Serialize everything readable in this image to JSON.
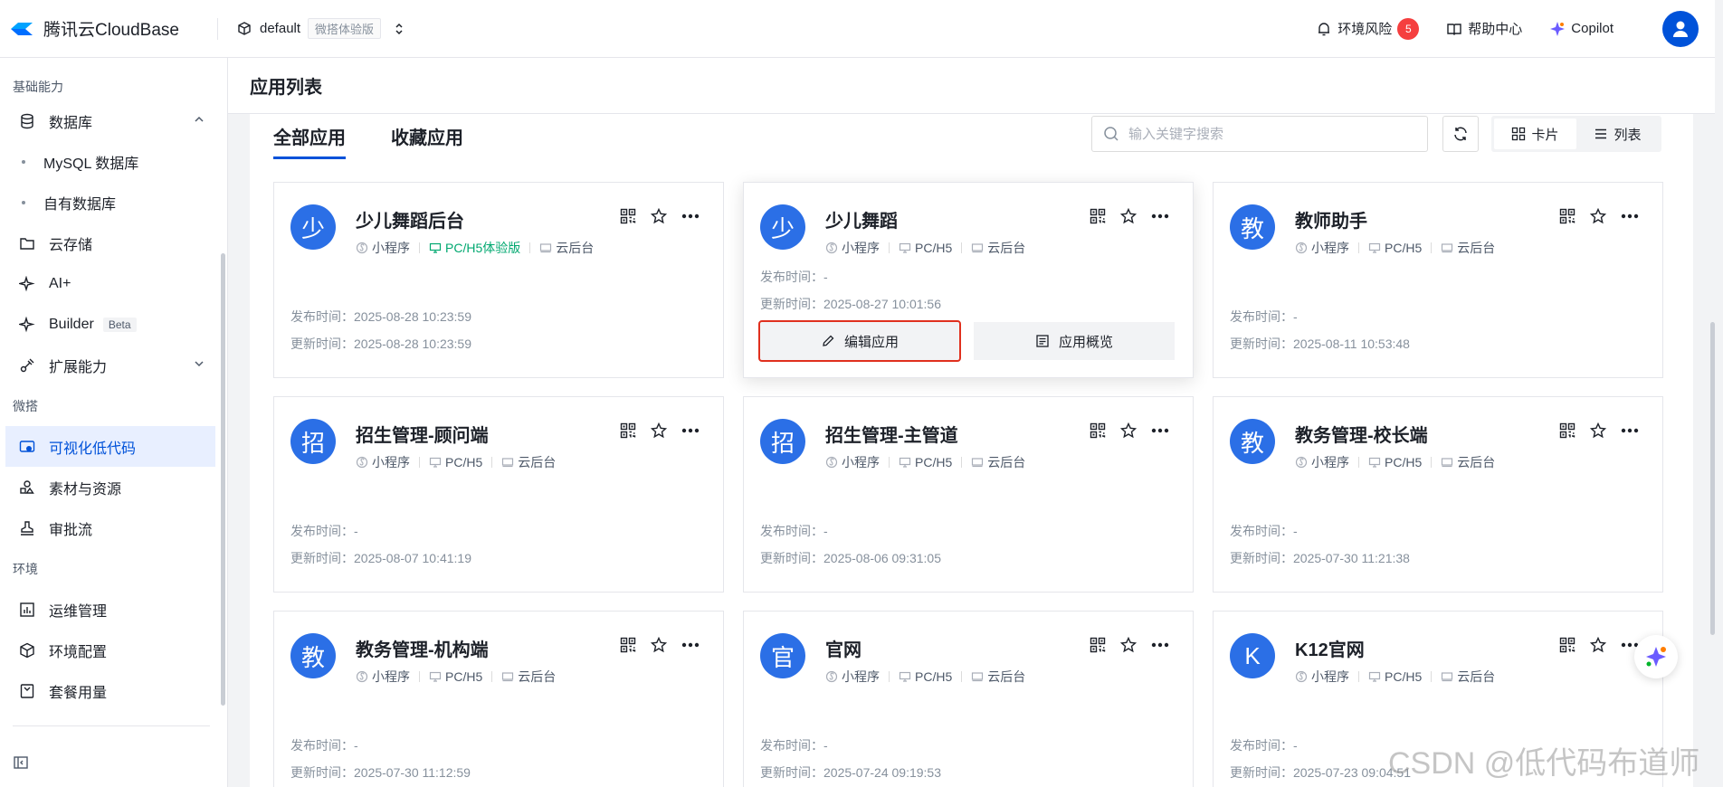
{
  "brand": {
    "name": "腾讯云CloudBase"
  },
  "env": {
    "name": "default",
    "tag": "微搭体验版"
  },
  "top_right": {
    "risk_label": "环境风险",
    "risk_count": "5",
    "help_label": "帮助中心",
    "copilot_label": "Copilot"
  },
  "sidebar": {
    "section_basic": "基础能力",
    "database": "数据库",
    "mysql": "MySQL 数据库",
    "own_db": "自有数据库",
    "storage": "云存储",
    "ai": "AI+",
    "builder": "Builder",
    "builder_badge": "Beta",
    "extension": "扩展能力",
    "section_weda": "微搭",
    "visual_lowcode": "可视化低代码",
    "assets": "素材与资源",
    "approval": "审批流",
    "section_env": "环境",
    "ops": "运维管理",
    "env_config": "环境配置",
    "plan_usage": "套餐用量"
  },
  "page": {
    "title": "应用列表"
  },
  "tabs": {
    "all": "全部应用",
    "favorites": "收藏应用"
  },
  "search": {
    "placeholder": "输入关键字搜索"
  },
  "view": {
    "card": "卡片",
    "list": "列表"
  },
  "labels": {
    "publish_time": "发布时间：",
    "update_time": "更新时间：",
    "edit_app": "编辑应用",
    "app_overview": "应用概览"
  },
  "apps": [
    {
      "avatar": "少",
      "name": "少儿舞蹈后台",
      "tags": [
        "小程序",
        "PC/H5体验版",
        "云后台"
      ],
      "publish": "2025-08-28 10:23:59",
      "update": "2025-08-28 10:23:59"
    },
    {
      "avatar": "少",
      "name": "少儿舞蹈",
      "tags": [
        "小程序",
        "PC/H5",
        "云后台"
      ],
      "publish": "-",
      "update": "2025-08-27 10:01:56"
    },
    {
      "avatar": "教",
      "name": "教师助手",
      "tags": [
        "小程序",
        "PC/H5",
        "云后台"
      ],
      "publish": "-",
      "update": "2025-08-11 10:53:48"
    },
    {
      "avatar": "招",
      "name": "招生管理-顾问端",
      "tags": [
        "小程序",
        "PC/H5",
        "云后台"
      ],
      "publish": "-",
      "update": "2025-08-07 10:41:19"
    },
    {
      "avatar": "招",
      "name": "招生管理-主管道",
      "tags": [
        "小程序",
        "PC/H5",
        "云后台"
      ],
      "publish": "-",
      "update": "2025-08-06 09:31:05"
    },
    {
      "avatar": "教",
      "name": "教务管理-校长端",
      "tags": [
        "小程序",
        "PC/H5",
        "云后台"
      ],
      "publish": "-",
      "update": "2025-07-30 11:21:38"
    },
    {
      "avatar": "教",
      "name": "教务管理-机构端",
      "tags": [
        "小程序",
        "PC/H5",
        "云后台"
      ],
      "publish": "-",
      "update": "2025-07-30 11:12:59"
    },
    {
      "avatar": "官",
      "name": "官网",
      "tags": [
        "小程序",
        "PC/H5",
        "云后台"
      ],
      "publish": "-",
      "update": "2025-07-24 09:19:53"
    },
    {
      "avatar": "K",
      "name": "K12官网",
      "tags": [
        "小程序",
        "PC/H5",
        "云后台"
      ],
      "publish": "-",
      "update": "2025-07-23 09:04:51"
    }
  ],
  "watermark": "CSDN @低代码布道师",
  "colors": {
    "primary": "#0052d9",
    "avatar": "#2b6fe6",
    "danger": "#f53f3f",
    "success": "#00a870"
  }
}
